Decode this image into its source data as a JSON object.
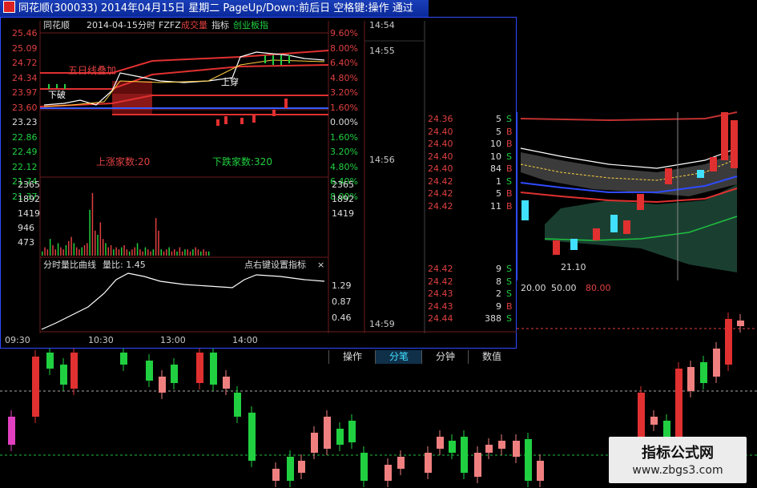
{
  "titlebar": {
    "text": "同花顺(300033) 2014年04月15日 星期二 PageUp/Down:前后日 空格键:操作 通过"
  },
  "intraday": {
    "header_name": "同花顺",
    "header_date": "2014-04-15",
    "header_label_1": "分时",
    "header_label_2": "FZFZ",
    "header_label_3": "成交量",
    "header_label_4": "指标",
    "header_label_5": "创业板指",
    "price_labels": [
      "25.46",
      "25.09",
      "24.72",
      "24.34",
      "23.97",
      "23.60",
      "23.23",
      "22.86",
      "22.49",
      "22.12",
      "21.74",
      "21.37"
    ],
    "pct_labels": [
      "9.60%",
      "8.00%",
      "6.40%",
      "4.80%",
      "3.20%",
      "1.60%",
      "0.00%",
      "1.60%",
      "3.20%",
      "4.80%",
      "6.40%",
      "8.00%"
    ],
    "annotation_up_count": "上涨家数:20",
    "annotation_down_count": "下跌家数:320",
    "annotation_breakdown": "下破",
    "annotation_cross": "五日线叠加",
    "annotation_up_breakout": "上穿",
    "volume_labels_left": [
      "2365",
      "1892",
      "1419",
      "946",
      "473"
    ],
    "volume_labels_right": [
      "2365",
      "1892",
      "1419"
    ],
    "ratio_title": "分时量比曲线",
    "ratio_value_label": "量比: 1.45",
    "ratio_hint": "点右键设置指标",
    "ratio_labels": [
      "1.29",
      "0.87",
      "0.46"
    ],
    "close_glyph": "×",
    "time_axis": [
      "09:30",
      "10:30",
      "13:00",
      "14:00"
    ]
  },
  "trades_top": {
    "times": [
      "14:54",
      "14:55",
      "14:56"
    ]
  },
  "trades_right": {
    "rows": [
      {
        "price": "24.36",
        "vol": "5",
        "side": "S"
      },
      {
        "price": "24.40",
        "vol": "5",
        "side": "B"
      },
      {
        "price": "24.40",
        "vol": "10",
        "side": "B"
      },
      {
        "price": "24.40",
        "vol": "10",
        "side": "S"
      },
      {
        "price": "24.40",
        "vol": "84",
        "side": "B"
      },
      {
        "price": "24.42",
        "vol": "1",
        "side": "S"
      },
      {
        "price": "24.42",
        "vol": "5",
        "side": "B"
      },
      {
        "price": "24.42",
        "vol": "11",
        "side": "B"
      }
    ]
  },
  "trades_bottom": {
    "time": "14:59",
    "rows": [
      {
        "price": "24.42",
        "vol": "9",
        "side": "S"
      },
      {
        "price": "24.42",
        "vol": "8",
        "side": "S"
      },
      {
        "price": "24.43",
        "vol": "2",
        "side": "S"
      },
      {
        "price": "24.43",
        "vol": "9",
        "side": "B"
      },
      {
        "price": "24.44",
        "vol": "388",
        "side": "S"
      }
    ]
  },
  "tabs": [
    "操作",
    "分笔",
    "分钟",
    "数值"
  ],
  "active_tab": "分笔",
  "ma_labels": {
    "label_1": "20.00",
    "label_2": "50.00",
    "label_3": "80.00",
    "low_price": "21.10"
  },
  "watermark": {
    "title": "指标公式网",
    "url": "www.zbgs3.com"
  },
  "colors": {
    "up": "#e04040",
    "down": "#20d040",
    "frame": "#2f4bff",
    "bg": "#000000"
  }
}
